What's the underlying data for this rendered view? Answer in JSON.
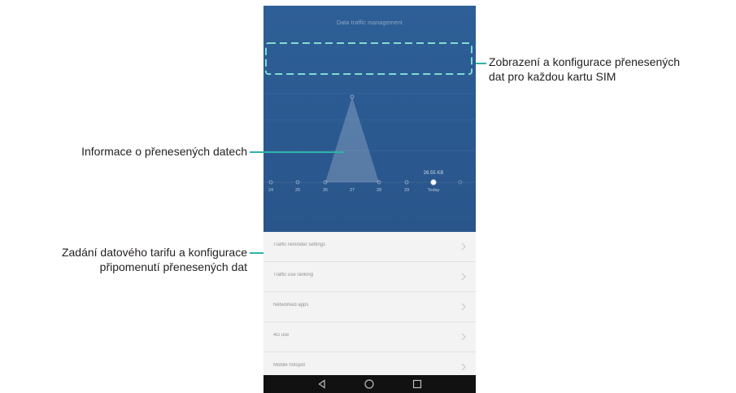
{
  "app": {
    "title": "Data traffic management"
  },
  "chart_data": {
    "type": "line",
    "categories": [
      "24",
      "25",
      "26",
      "27",
      "28",
      "29",
      "Today"
    ],
    "values": [
      0,
      0,
      0,
      1,
      0,
      0,
      0
    ],
    "peak_label": "",
    "today_value_label": "26.55 KB",
    "xlabel": "",
    "ylabel": ""
  },
  "list": {
    "items": [
      {
        "label": "Traffic reminder settings"
      },
      {
        "label": "Traffic use ranking"
      },
      {
        "label": "Networked apps"
      },
      {
        "label": "4G use"
      },
      {
        "label": "Mobile hotspot"
      }
    ]
  },
  "annotations": {
    "sim": {
      "line1": "Zobrazení a konfigurace přenesených",
      "line2": "dat pro každou kartu SIM"
    },
    "info": {
      "line1": "Informace o přenesených datech"
    },
    "plan": {
      "line1": "Zadání datového tarifu a konfigurace",
      "line2": "připomenutí přenesených dat"
    }
  },
  "colors": {
    "header_blue": "#2e5f96",
    "dashed_highlight": "#7fdcd2",
    "annotation_line": "#2fb3a8"
  },
  "icons": {
    "nav": [
      "back-icon",
      "home-icon",
      "recents-icon"
    ],
    "list_chevron": "chevron-right-icon"
  }
}
